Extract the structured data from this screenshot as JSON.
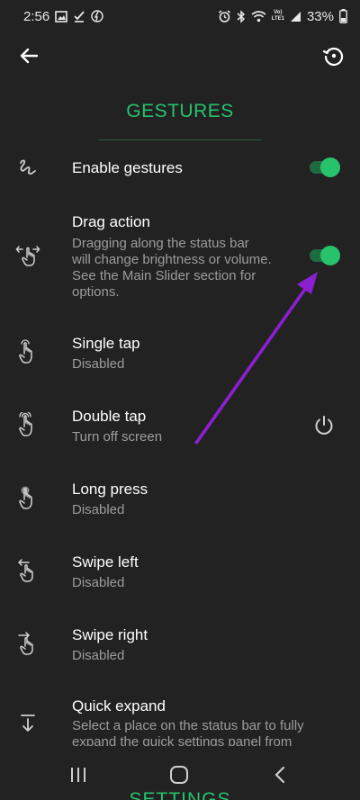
{
  "status_bar": {
    "time": "2:56",
    "battery": "33%",
    "left_icons": [
      "gallery-icon",
      "check-download-icon",
      "activity-icon"
    ],
    "right_icons": [
      "alarm-icon",
      "bluetooth-icon",
      "wifi-icon",
      "lte-signal-icon",
      "battery-icon"
    ],
    "network_label_top": "Vo)",
    "network_label_bottom": "LTE1"
  },
  "app_bar": {
    "back_icon": "back-arrow-icon",
    "restore_icon": "restore-icon"
  },
  "page": {
    "title": "GESTURES",
    "accent_color": "#27c26c"
  },
  "items": [
    {
      "title": "Enable gestures",
      "icon": "gesture-squiggle-icon",
      "control": "toggle",
      "state": "on"
    },
    {
      "title": "Drag action",
      "subtitle_lines": [
        "Dragging along the status bar",
        "will change brightness or volume.",
        "See the Main Slider section for",
        "options."
      ],
      "icon": "drag-gesture-icon",
      "control": "toggle",
      "state": "on"
    },
    {
      "title": "Single tap",
      "subtitle": "Disabled",
      "icon": "single-tap-icon"
    },
    {
      "title": "Double tap",
      "subtitle": "Turn off screen",
      "icon": "double-tap-icon",
      "action_icon": "power-icon"
    },
    {
      "title": "Long press",
      "subtitle": "Disabled",
      "icon": "long-press-icon"
    },
    {
      "title": "Swipe left",
      "subtitle": "Disabled",
      "icon": "swipe-left-icon"
    },
    {
      "title": "Swipe right",
      "subtitle": "Disabled",
      "icon": "swipe-right-icon"
    },
    {
      "title": "Quick expand",
      "subtitle_lines": [
        "Select a place on the status bar to fully",
        "expand the quick settings panel from"
      ],
      "icon": "quick-expand-icon"
    }
  ],
  "bottom": {
    "section_peek": "SETTINGS",
    "nav_icons": [
      "recents-icon",
      "home-icon",
      "back-icon"
    ]
  },
  "annotation": {
    "arrow_color": "#8b1fd1"
  }
}
